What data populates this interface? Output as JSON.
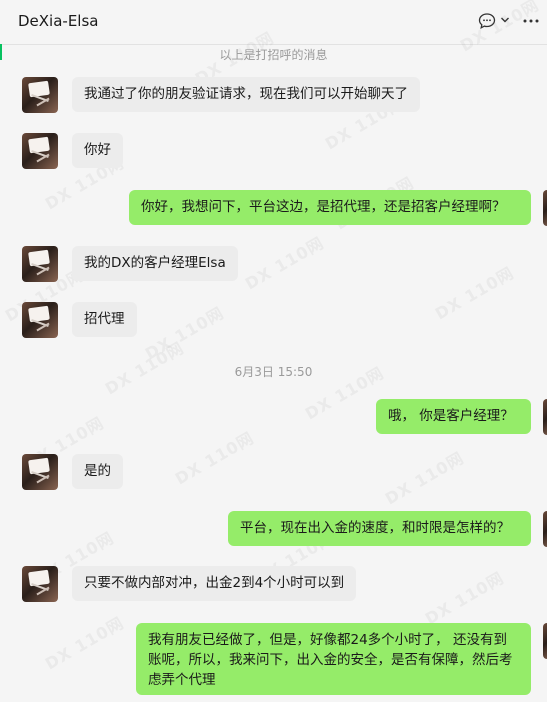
{
  "header": {
    "title": "DeXia-Elsa"
  },
  "system": {
    "greeting_notice": "以上是打招呼的消息",
    "timestamp": "6月3日 15:50"
  },
  "messages": [
    {
      "side": "in",
      "text": "我通过了你的朋友验证请求，现在我们可以开始聊天了"
    },
    {
      "side": "in",
      "text": "你好"
    },
    {
      "side": "out",
      "text": "你好，我想问下，平台这边，是招代理，还是招客户经理啊？"
    },
    {
      "side": "in",
      "text": "我的DX的客户经理Elsa"
    },
    {
      "side": "in",
      "text": "招代理"
    },
    {
      "side": "out",
      "text": "哦， 你是客户经理？"
    },
    {
      "side": "in",
      "text": "是的"
    },
    {
      "side": "out",
      "text": "平台，现在出入金的速度，和时限是怎样的？"
    },
    {
      "side": "in",
      "text": "只要不做内部对冲，出金2到4个小时可以到"
    },
    {
      "side": "out",
      "text": "我有朋友已经做了，但是，好像都24多个小时了， 还没有到账呢，所以，我来问下，出入金的安全，是否有保障，然后考虑弄个代理"
    }
  ],
  "watermark": {
    "text": "DX 110网"
  },
  "colors": {
    "incoming_bubble": "#ececec",
    "outgoing_bubble": "#95ec69",
    "background": "#f5f5f5"
  }
}
